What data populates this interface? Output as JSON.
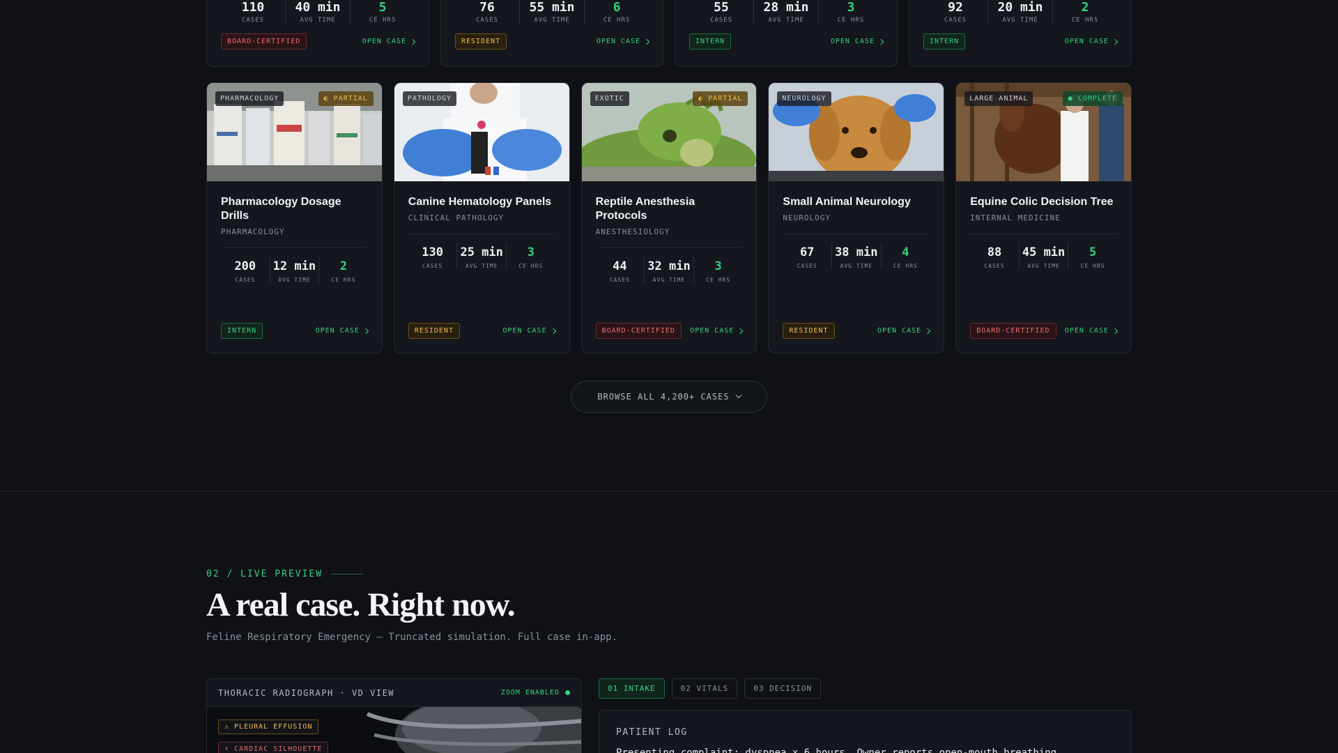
{
  "top_cards": [
    {
      "stats": [
        {
          "value": "110",
          "label": "CASES"
        },
        {
          "value": "40 min",
          "label": "AVG TIME"
        },
        {
          "value": "5",
          "label": "CE HRS"
        }
      ],
      "level": "BOARD-CERTIFIED",
      "action": "OPEN CASE"
    },
    {
      "stats": [
        {
          "value": "76",
          "label": "CASES"
        },
        {
          "value": "55 min",
          "label": "AVG TIME"
        },
        {
          "value": "6",
          "label": "CE HRS"
        }
      ],
      "level": "RESIDENT",
      "action": "OPEN CASE"
    },
    {
      "stats": [
        {
          "value": "55",
          "label": "CASES"
        },
        {
          "value": "28 min",
          "label": "AVG TIME"
        },
        {
          "value": "3",
          "label": "CE HRS"
        }
      ],
      "level": "INTERN",
      "action": "OPEN CASE"
    },
    {
      "stats": [
        {
          "value": "92",
          "label": "CASES"
        },
        {
          "value": "20 min",
          "label": "AVG TIME"
        },
        {
          "value": "2",
          "label": "CE HRS"
        }
      ],
      "level": "INTERN",
      "action": "OPEN CASE"
    }
  ],
  "cards": [
    {
      "tag": "PHARMACOLOGY",
      "status": "◐ PARTIAL",
      "title": "Pharmacology Dosage Drills",
      "subtitle": "PHARMACOLOGY",
      "stats": [
        {
          "value": "200",
          "label": "CASES"
        },
        {
          "value": "12 min",
          "label": "AVG TIME"
        },
        {
          "value": "2",
          "label": "CE HRS"
        }
      ],
      "level": "INTERN",
      "action": "OPEN CASE"
    },
    {
      "tag": "PATHOLOGY",
      "status": "",
      "title": "Canine Hematology Panels",
      "subtitle": "CLINICAL PATHOLOGY",
      "stats": [
        {
          "value": "130",
          "label": "CASES"
        },
        {
          "value": "25 min",
          "label": "AVG TIME"
        },
        {
          "value": "3",
          "label": "CE HRS"
        }
      ],
      "level": "RESIDENT",
      "action": "OPEN CASE"
    },
    {
      "tag": "EXOTIC",
      "status": "◐ PARTIAL",
      "title": "Reptile Anesthesia Protocols",
      "subtitle": "ANESTHESIOLOGY",
      "stats": [
        {
          "value": "44",
          "label": "CASES"
        },
        {
          "value": "32 min",
          "label": "AVG TIME"
        },
        {
          "value": "3",
          "label": "CE HRS"
        }
      ],
      "level": "BOARD-CERTIFIED",
      "action": "OPEN CASE"
    },
    {
      "tag": "NEUROLOGY",
      "status": "",
      "title": "Small Animal Neurology",
      "subtitle": "NEUROLOGY",
      "stats": [
        {
          "value": "67",
          "label": "CASES"
        },
        {
          "value": "38 min",
          "label": "AVG TIME"
        },
        {
          "value": "4",
          "label": "CE HRS"
        }
      ],
      "level": "RESIDENT",
      "action": "OPEN CASE"
    },
    {
      "tag": "LARGE ANIMAL",
      "status": "● COMPLETE",
      "title": "Equine Colic Decision Tree",
      "subtitle": "INTERNAL MEDICINE",
      "stats": [
        {
          "value": "88",
          "label": "CASES"
        },
        {
          "value": "45 min",
          "label": "AVG TIME"
        },
        {
          "value": "5",
          "label": "CE HRS"
        }
      ],
      "level": "BOARD-CERTIFIED",
      "action": "OPEN CASE"
    }
  ],
  "browse_label": "BROWSE ALL 4,200+ CASES",
  "preview": {
    "eyebrow": "02 / LIVE PREVIEW",
    "headline": "A real case. Right now.",
    "subline": "Feline Respiratory Emergency — Truncated simulation. Full case in-app.",
    "xray_title": "THORACIC RADIOGRAPH · VD VIEW",
    "zoom": "ZOOM ENABLED",
    "findings": [
      "⚠ PLEURAL EFFUSION",
      "↑ CARDIAC SILHOUETTE"
    ],
    "tabs": [
      "01 INTAKE",
      "02 VITALS",
      "03 DECISION"
    ],
    "log_title": "PATIENT LOG",
    "log_text": "Presenting complaint: dyspnea x 6 hours. Owner reports open-mouth breathing."
  },
  "colors": {
    "accent": "#36d07e",
    "warning": "#f2b84b",
    "danger": "#ef6b6b",
    "background": "#0f1116"
  }
}
